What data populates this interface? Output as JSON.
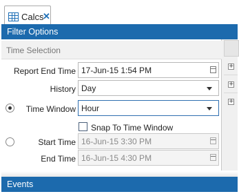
{
  "tab": {
    "label": "Calcs",
    "close": "✕"
  },
  "filter_header": "Filter Options",
  "section": {
    "title": "Time Selection"
  },
  "fields": {
    "report_end_time": {
      "label": "Report End Time",
      "value": "17-Jun-15 1:54 PM"
    },
    "history": {
      "label": "History",
      "value": "Day"
    },
    "time_window": {
      "label": "Time Window",
      "value": "Hour",
      "selected": true
    },
    "snap": {
      "label": "Snap To Time Window",
      "checked": false
    },
    "start_time": {
      "label": "Start Time",
      "value": "16-Jun-15 3:30 PM",
      "disabled": true
    },
    "end_time": {
      "label": "End Time",
      "value": "16-Jun-15 4:30 PM",
      "disabled": true
    }
  },
  "right_pane": {
    "expanders": [
      "+",
      "+",
      "+"
    ]
  },
  "events_header": "Events",
  "colors": {
    "header_blue": "#1c6aad",
    "accent": "#1e6fb6"
  }
}
